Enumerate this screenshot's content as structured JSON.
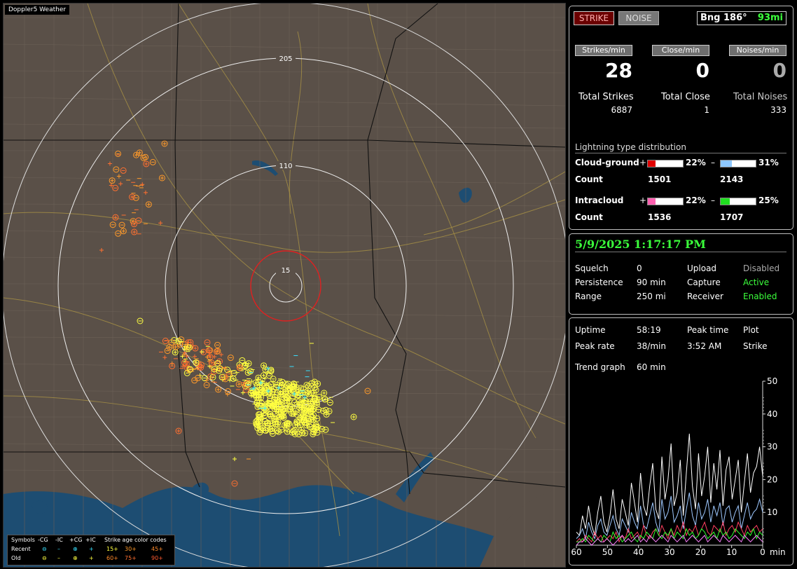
{
  "map": {
    "title": "Doppler5 Weather",
    "ring_labels": [
      "205",
      "110",
      "15"
    ],
    "legend": {
      "headers": [
        "Symbols",
        "-CG",
        "-IC",
        "+CG",
        "+IC",
        "Strike age color codes"
      ],
      "rows": [
        {
          "label": "Recent",
          "ages": [
            "15+",
            "30+",
            "45+"
          ]
        },
        {
          "label": "Old",
          "ages": [
            "60+",
            "75+",
            "90+"
          ]
        }
      ],
      "age_colors": [
        "#ffff40",
        "#ff9a2a",
        "#ff7030"
      ]
    }
  },
  "status": {
    "strike_button": "STRIKE",
    "noise_button": "NOISE",
    "bearing_label": "Bng 186°",
    "bearing_distance": "93mi",
    "rate_headers": [
      "Strikes/min",
      "Close/min",
      "Noises/min"
    ],
    "rates": [
      "28",
      "0",
      "0"
    ],
    "total_labels": [
      "Total Strikes",
      "Total Close",
      "Total Noises"
    ],
    "totals": [
      "6887",
      "1",
      "333"
    ],
    "distribution_title": "Lightning type distribution",
    "cg_label": "Cloud-ground",
    "ic_label": "Intracloud",
    "count_label": "Count",
    "plus": "+",
    "minus": "–",
    "cg_pos_pct": "22%",
    "cg_neg_pct": "31%",
    "cg_pos_count": "1501",
    "cg_neg_count": "2143",
    "ic_pos_pct": "22%",
    "ic_neg_pct": "25%",
    "ic_pos_count": "1536",
    "ic_neg_count": "1707",
    "bar_fractions": [
      0.22,
      0.31,
      0.22,
      0.25
    ],
    "bar_colors": [
      "#e00000",
      "#8ec8ff",
      "#ff60b0",
      "#20e020"
    ]
  },
  "settings": {
    "datetime": "5/9/2025 1:17:17 PM",
    "rows": [
      {
        "k1": "Squelch",
        "v1": "0",
        "k2": "Upload",
        "v2": "Disabled"
      },
      {
        "k1": "Persistence",
        "v1": "90 min",
        "k2": "Capture",
        "v2": "Active"
      },
      {
        "k1": "Range",
        "v1": "250 mi",
        "k2": "Receiver",
        "v2": "Enabled"
      }
    ]
  },
  "trend": {
    "uptime_label": "Uptime",
    "uptime": "58:19",
    "peak_time_label": "Peak time",
    "plot_label": "Plot",
    "peak_rate_label": "Peak rate",
    "peak_rate": "38/min",
    "peak_time": "3:52 AM",
    "plot_value": "Strike",
    "trend_graph_label": "Trend graph",
    "trend_graph_value": "60 min",
    "y_ticks": [
      "50",
      "40",
      "30",
      "20",
      "10"
    ],
    "x_ticks": [
      "60",
      "50",
      "40",
      "30",
      "20",
      "10",
      "0"
    ],
    "x_unit": "min"
  },
  "chart_data": {
    "type": "line",
    "x_label": "min",
    "ylim": [
      0,
      50
    ],
    "xlim": [
      60,
      0
    ],
    "series": [
      {
        "color": "#ffffff",
        "values": [
          4,
          3,
          9,
          5,
          12,
          6,
          3,
          10,
          15,
          7,
          4,
          9,
          17,
          8,
          5,
          14,
          10,
          6,
          19,
          13,
          7,
          22,
          12,
          9,
          18,
          25,
          11,
          8,
          27,
          14,
          20,
          31,
          12,
          16,
          26,
          9,
          22,
          34,
          18,
          11,
          28,
          15,
          21,
          30,
          13,
          25,
          17,
          29,
          12,
          23,
          27,
          14,
          20,
          26,
          10,
          19,
          28,
          16,
          22,
          24,
          30,
          21
        ]
      },
      {
        "color": "#9ec8ff",
        "values": [
          2,
          3,
          5,
          2,
          7,
          4,
          2,
          6,
          8,
          4,
          3,
          6,
          9,
          5,
          3,
          8,
          6,
          4,
          10,
          7,
          5,
          12,
          6,
          5,
          9,
          13,
          7,
          4,
          14,
          8,
          10,
          15,
          7,
          9,
          12,
          5,
          11,
          16,
          9,
          6,
          13,
          8,
          10,
          14,
          7,
          12,
          9,
          13,
          6,
          11,
          12,
          7,
          10,
          12,
          5,
          9,
          13,
          8,
          10,
          11,
          14,
          10
        ]
      },
      {
        "color": "#ff4060",
        "values": [
          1,
          2,
          1,
          3,
          2,
          1,
          4,
          2,
          3,
          1,
          2,
          3,
          2,
          4,
          1,
          3,
          2,
          5,
          2,
          3,
          4,
          2,
          6,
          3,
          2,
          4,
          5,
          3,
          6,
          4,
          2,
          5,
          3,
          6,
          4,
          7,
          3,
          5,
          4,
          6,
          3,
          5,
          7,
          4,
          3,
          6,
          5,
          4,
          7,
          3,
          5,
          6,
          4,
          7,
          5,
          3,
          6,
          4,
          5,
          6,
          4,
          5
        ]
      },
      {
        "color": "#30ff30",
        "values": [
          1,
          1,
          2,
          1,
          3,
          2,
          1,
          2,
          1,
          3,
          2,
          1,
          4,
          2,
          3,
          1,
          2,
          3,
          4,
          2,
          1,
          3,
          2,
          4,
          3,
          2,
          5,
          3,
          2,
          4,
          3,
          5,
          2,
          4,
          3,
          2,
          5,
          3,
          4,
          2,
          3,
          5,
          4,
          2,
          3,
          4,
          2,
          5,
          3,
          4,
          2,
          3,
          5,
          4,
          3,
          2,
          4,
          3,
          5,
          2,
          4,
          3
        ]
      },
      {
        "color": "#ff80ff",
        "values": [
          0,
          1,
          1,
          2,
          1,
          0,
          1,
          2,
          1,
          1,
          2,
          1,
          0,
          1,
          2,
          3,
          1,
          2,
          1,
          2,
          3,
          1,
          2,
          1,
          3,
          2,
          1,
          2,
          3,
          2,
          1,
          3,
          2,
          1,
          2,
          3,
          1,
          2,
          3,
          2,
          1,
          2,
          3,
          1,
          2,
          3,
          2,
          1,
          3,
          2,
          1,
          2,
          3,
          2,
          1,
          3,
          2,
          1,
          2,
          3,
          2,
          1
        ]
      }
    ]
  }
}
